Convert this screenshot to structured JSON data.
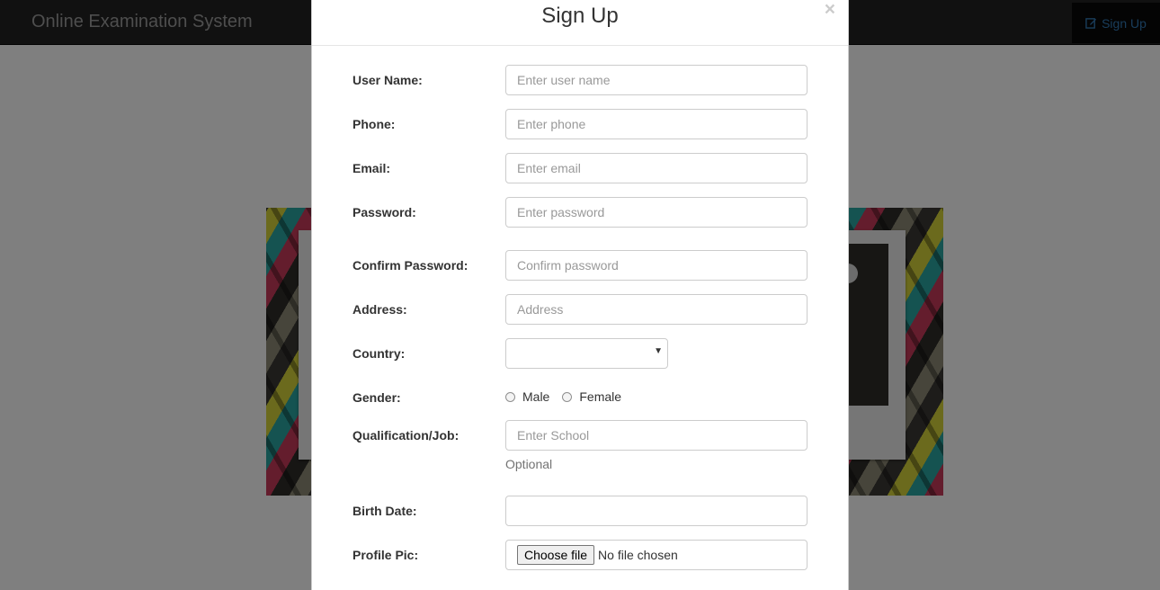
{
  "navbar": {
    "brand": "Online Examination System",
    "signup_label": "Sign Up",
    "signup_icon": "edit-icon"
  },
  "modal": {
    "title": "Sign Up",
    "close_glyph": "×",
    "fields": {
      "username": {
        "label": "User Name:",
        "placeholder": "Enter user name"
      },
      "phone": {
        "label": "Phone:",
        "placeholder": "Enter phone"
      },
      "email": {
        "label": "Email:",
        "placeholder": "Enter email"
      },
      "password": {
        "label": "Password:",
        "placeholder": "Enter password"
      },
      "confirm_password": {
        "label": "Confirm Password:",
        "placeholder": "Confirm password"
      },
      "address": {
        "label": "Address:",
        "placeholder": "Address"
      },
      "country": {
        "label": "Country:",
        "selected": ""
      },
      "gender": {
        "label": "Gender:",
        "options": [
          "Male",
          "Female"
        ]
      },
      "qualification": {
        "label": "Qualification/Job:",
        "placeholder": "Enter School",
        "help": "Optional"
      },
      "birth_date": {
        "label": "Birth Date:",
        "value": ""
      },
      "profile_pic": {
        "label": "Profile Pic:",
        "button": "Choose file",
        "status": "No file chosen"
      }
    }
  }
}
